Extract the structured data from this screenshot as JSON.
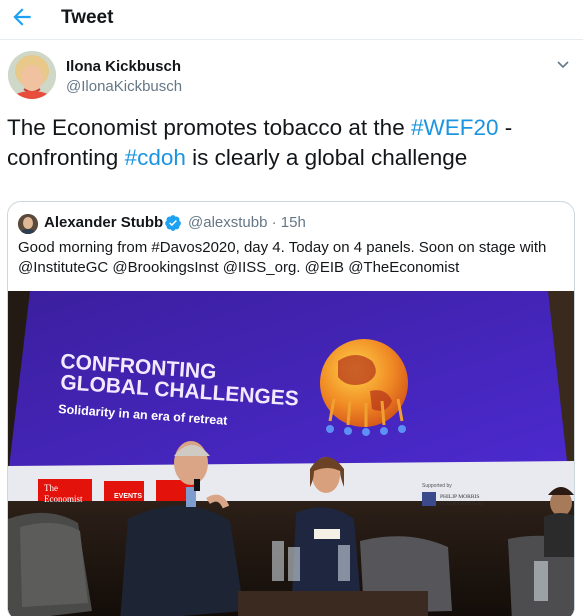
{
  "header": {
    "title": "Tweet",
    "back_icon": "arrow-left-icon"
  },
  "tweet": {
    "author_name": "Ilona Kickbusch",
    "author_handle": "@IlonaKickbusch",
    "text_part1": "The Economist promotes tobacco at the ",
    "hashtag1": "#WEF20",
    "text_part2": " - confronting ",
    "hashtag2": "#cdoh",
    "text_part3": " is clearly a global challenge"
  },
  "quoted_tweet": {
    "author_name": "Alexander Stubb",
    "verified_icon": "verified-badge-icon",
    "author_handle": "@alexstubb",
    "separator": "·",
    "time": "15h",
    "text": "Good morning from #Davos2020, day 4. Today on 4 panels. Soon on stage with @InstituteGC @BrookingsInst @IISS_org. @EIB @TheEconomist",
    "photo": {
      "screen_line1": "CONFRONTING",
      "screen_line2": "GLOBAL CHALLENGES",
      "screen_line3": "Solidarity in an era of retreat",
      "logo_line1": "The",
      "logo_line2": "Economist",
      "events_label": "EVENTS",
      "supporter_label": "Supported by",
      "supporter_name": "PHILIP MORRIS",
      "supporter_sub": "INTERNATIONAL"
    }
  },
  "colors": {
    "accent": "#1da1f2",
    "link": "#1b95e0",
    "secondary_text": "#657786",
    "border": "#e6ecf0",
    "economist_red": "#e3120b"
  }
}
